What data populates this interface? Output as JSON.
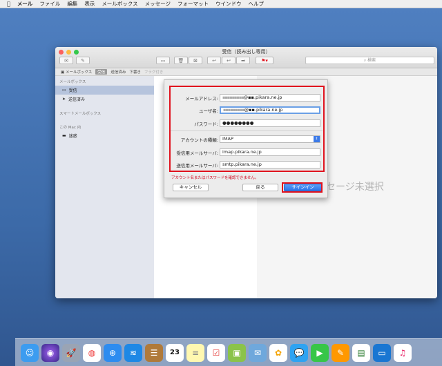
{
  "menubar": {
    "apple": "",
    "app": "メール",
    "items": [
      "ファイル",
      "編集",
      "表示",
      "メールボックス",
      "メッセージ",
      "フォーマット",
      "ウインドウ",
      "ヘルプ"
    ]
  },
  "window": {
    "title": "受信（読み出し専用）",
    "search_placeholder": "検索",
    "favorites": {
      "mailboxes": "メールボックス",
      "inbox": "受信",
      "sent": "送信済み",
      "drafts": "下書き",
      "flagged": "フラグ付き"
    },
    "sidebar": {
      "section_mailboxes": "メールボックス",
      "inbox": "受信",
      "sent": "送信済み",
      "section_smart": "スマートメールボックス",
      "section_onmac": "この Mac 内",
      "trash": "迷惑"
    },
    "no_message": "セージ未選択"
  },
  "sheet": {
    "email_label": "メールアドレス:",
    "email_value_masked": "▪▪▪▪▪▪▪▪▪",
    "email_value": "@▪▪.pikara.ne.jp",
    "username_label": "ユーザ名:",
    "username_value_masked": "▪▪▪▪▪▪▪▪▪",
    "username_value": "@▪▪.pikara.ne.jp",
    "password_label": "パスワード:",
    "password_value": "●●●●●●●●",
    "account_type_label": "アカウントの種類:",
    "account_type_value": "IMAP",
    "incoming_label": "受信用メールサーバ:",
    "incoming_value": "imap.pikara.ne.jp",
    "outgoing_label": "送信用メールサーバ:",
    "outgoing_value": "smtp.pikara.ne.jp",
    "error_text": "アカウント名またはパスワードを確認できません。",
    "cancel_label": "キャンセル",
    "back_label": "戻る",
    "signin_label": "サインイン"
  },
  "dock": {
    "calendar_day": "23"
  },
  "colors": {
    "highlight_red": "#e0121d",
    "primary_blue": "#2c74e8",
    "error_red": "#d0021b"
  }
}
